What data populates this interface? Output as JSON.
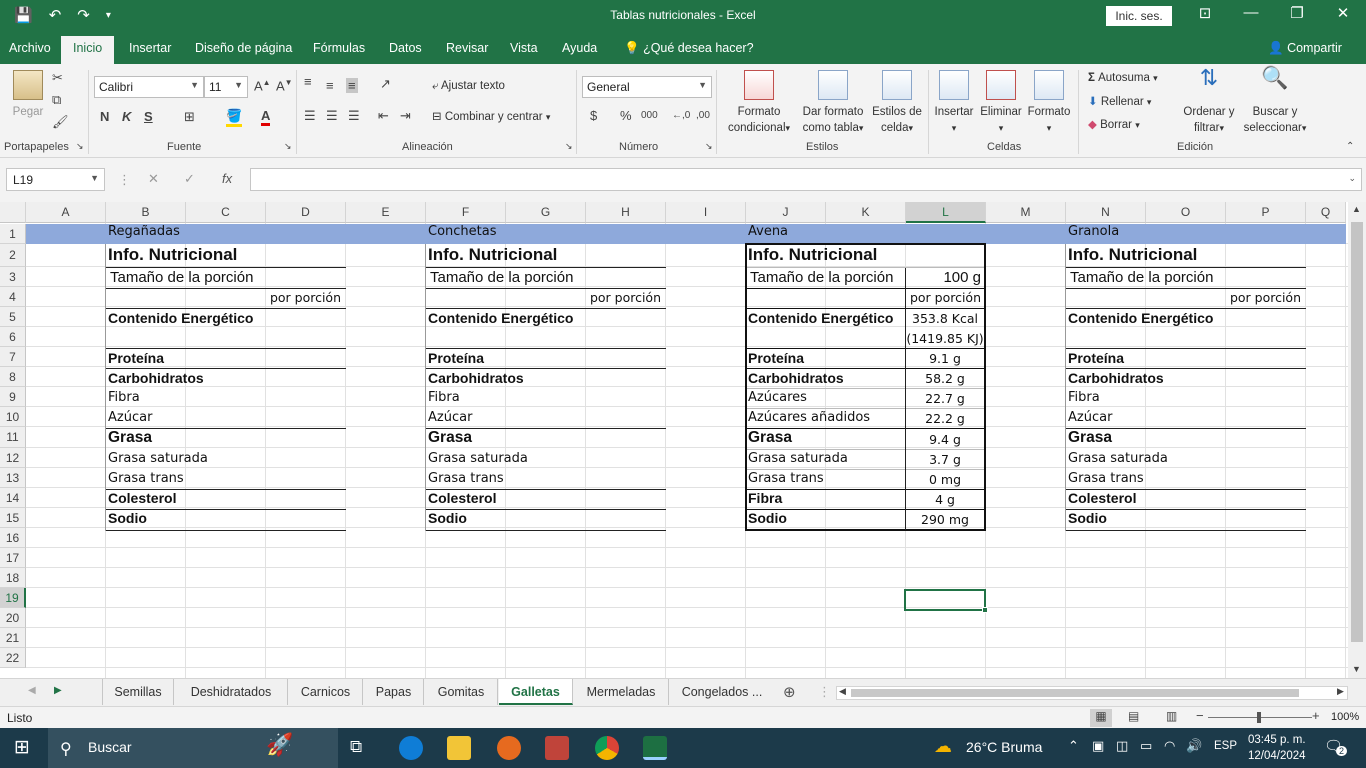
{
  "window": {
    "title": "Tablas nutricionales  -  Excel",
    "sign_in": "Inic. ses.",
    "minimize": "—",
    "restore": "❐",
    "close": "✕",
    "ribbon_display": "⊡"
  },
  "menu": {
    "tabs": [
      "Archivo",
      "Inicio",
      "Insertar",
      "Diseño de página",
      "Fórmulas",
      "Datos",
      "Revisar",
      "Vista",
      "Ayuda"
    ],
    "tell_me": "¿Qué desea hacer?",
    "share": "Compartir"
  },
  "ribbon": {
    "paste": "Pegar",
    "clipboard_group": "Portapapeles",
    "font_name": "Calibri",
    "font_size": "11",
    "bold": "N",
    "italic": "K",
    "underline": "S",
    "font_group": "Fuente",
    "wrap_text": "Ajustar texto",
    "merge_center": "Combinar y centrar",
    "alignment_group": "Alineación",
    "number_format": "General",
    "currency": "$",
    "percent": "%",
    "thousands": "000",
    "number_group": "Número",
    "cond_format": [
      "Formato",
      "condicional"
    ],
    "format_table": [
      "Dar formato",
      "como tabla"
    ],
    "cell_styles": [
      "Estilos de",
      "celda"
    ],
    "styles_group": "Estilos",
    "insert": "Insertar",
    "delete": "Eliminar",
    "format": "Formato",
    "cells_group": "Celdas",
    "autosum": "Autosuma",
    "fill": "Rellenar",
    "clear": "Borrar",
    "sort_filter": [
      "Ordenar y",
      "filtrar"
    ],
    "find_select": [
      "Buscar y",
      "seleccionar"
    ],
    "editing_group": "Edición"
  },
  "formula_bar": {
    "name_box": "L19",
    "formula": ""
  },
  "grid": {
    "columns": [
      "A",
      "B",
      "C",
      "D",
      "E",
      "F",
      "G",
      "H",
      "I",
      "J",
      "K",
      "L",
      "M",
      "N",
      "O",
      "P",
      "Q"
    ],
    "rows": [
      "1",
      "2",
      "3",
      "4",
      "5",
      "6",
      "7",
      "8",
      "9",
      "10",
      "11",
      "12",
      "13",
      "14",
      "15",
      "16",
      "17",
      "18",
      "19",
      "20",
      "21",
      "22"
    ],
    "selected_cell": "L19"
  },
  "tables": {
    "regañadas": {
      "name": "Regañadas",
      "title": "Info. Nutricional",
      "serving": "Tamaño de la porción",
      "per_serving": "por porción",
      "energy": "Contenido Energético",
      "protein": "Proteína",
      "carbs": "Carbohidratos",
      "fiber": "Fibra",
      "sugar": "Azúcar",
      "fat": "Grasa",
      "sat_fat": "Grasa saturada",
      "trans_fat": "Grasa trans",
      "cholesterol": "Colesterol",
      "sodium": "Sodio"
    },
    "conchetas": {
      "name": "Conchetas",
      "title": "Info. Nutricional",
      "serving": "Tamaño de la porción",
      "per_serving": "por porción",
      "energy": "Contenido Energético",
      "protein": "Proteína",
      "carbs": "Carbohidratos",
      "fiber": "Fibra",
      "sugar": "Azúcar",
      "fat": "Grasa",
      "sat_fat": "Grasa saturada",
      "trans_fat": "Grasa trans",
      "cholesterol": "Colesterol",
      "sodium": "Sodio"
    },
    "avena": {
      "name": "Avena",
      "title": "Info. Nutricional",
      "serving": "Tamaño de la porción",
      "serving_value": "100 g",
      "per_serving": "por porción",
      "energy": "Contenido Energético",
      "energy_kcal": "353.8 Kcal",
      "energy_kj": "(1419.85 KJ)",
      "protein": "Proteína",
      "protein_value": "9.1 g",
      "carbs": "Carbohidratos",
      "carbs_value": "58.2 g",
      "sugars": "Azúcares",
      "sugars_value": "22.7 g",
      "added_sugars": "Azúcares añadidos",
      "added_sugars_value": "22.2 g",
      "fat": "Grasa",
      "fat_value": "9.4 g",
      "sat_fat": "Grasa saturada",
      "sat_fat_value": "3.7 g",
      "trans_fat": "Grasa trans",
      "trans_fat_value": "0 mg",
      "fiber": "Fibra",
      "fiber_value": "4 g",
      "sodium": "Sodio",
      "sodium_value": "290 mg"
    },
    "granola": {
      "name": "Granola",
      "title": "Info. Nutricional",
      "serving": "Tamaño de la porción",
      "per_serving": "por porción",
      "energy": "Contenido Energético",
      "protein": "Proteína",
      "carbs": "Carbohidratos",
      "fiber": "Fibra",
      "sugar": "Azúcar",
      "fat": "Grasa",
      "sat_fat": "Grasa saturada",
      "trans_fat": "Grasa trans",
      "cholesterol": "Colesterol",
      "sodium": "Sodio"
    }
  },
  "sheets": {
    "tabs": [
      "Semillas",
      "Deshidratados",
      "Carnicos",
      "Papas",
      "Gomitas",
      "Galletas",
      "Mermeladas",
      "Congelados ..."
    ],
    "active": "Galletas"
  },
  "status": {
    "ready": "Listo",
    "zoom": "100%"
  },
  "taskbar": {
    "search": "Buscar",
    "weather": "26°C  Bruma",
    "lang": "ESP",
    "time": "03:45 p. m.",
    "date": "12/04/2024",
    "notifications": "2"
  },
  "colors": {
    "excel_green": "#217346",
    "header_band": "#8ea9db"
  }
}
